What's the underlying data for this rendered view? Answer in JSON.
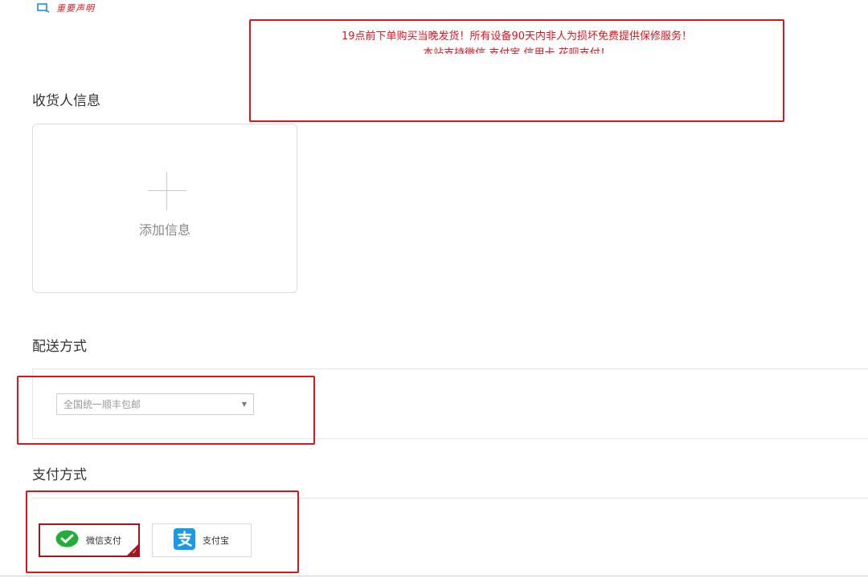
{
  "notice": {
    "link_label": "重要声明",
    "icon": "search-icon"
  },
  "announcement": {
    "line1": "19点前下单购买当晚发货！所有设备90天内非人为损坏免费提供保修服务！",
    "line2": "本站支持微信 支付宝 信用卡 花呗支付！"
  },
  "consignee": {
    "title": "收货人信息",
    "add_label": "添加信息",
    "icon": "plus-icon"
  },
  "delivery": {
    "title": "配送方式",
    "selected": "全国统一顺丰包邮",
    "arrow": "▼"
  },
  "payment": {
    "title": "支付方式",
    "options": [
      {
        "label": "微信支付",
        "icon": "wechat-pay-icon",
        "selected": true
      },
      {
        "label": "支付宝",
        "icon": "alipay-icon",
        "selected": false
      }
    ]
  },
  "colors": {
    "highlight_red": "#d8161b",
    "notice_red": "#e0141e",
    "wechat_green": "#22ac38",
    "alipay_blue": "#1a9ae6"
  }
}
